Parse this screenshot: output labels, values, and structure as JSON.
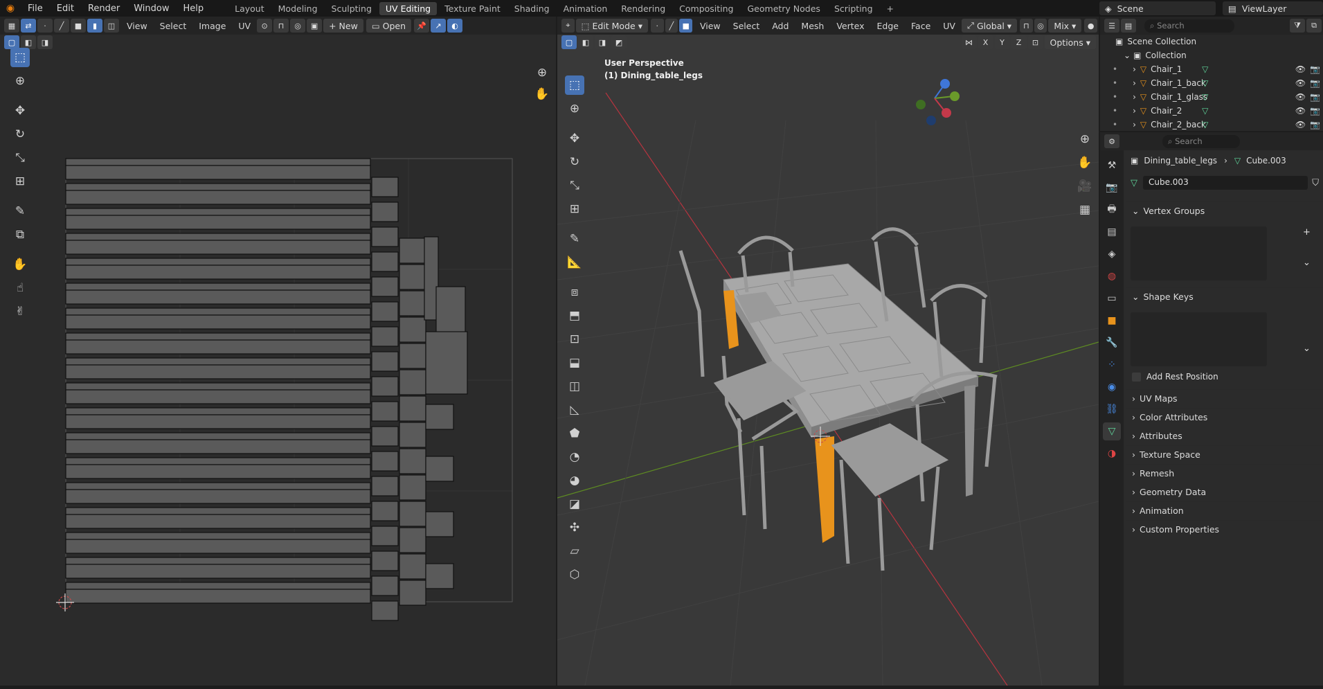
{
  "menu": {
    "items": [
      "File",
      "Edit",
      "Render",
      "Window",
      "Help"
    ]
  },
  "workspaces": {
    "tabs": [
      "Layout",
      "Modeling",
      "Sculpting",
      "UV Editing",
      "Texture Paint",
      "Shading",
      "Animation",
      "Rendering",
      "Compositing",
      "Geometry Nodes",
      "Scripting"
    ],
    "active": "UV Editing",
    "add": "+"
  },
  "scene": {
    "name": "Scene",
    "view_layer": "ViewLayer"
  },
  "uv_editor": {
    "menus": [
      "View",
      "Select",
      "Image",
      "UV"
    ],
    "new_label": "New",
    "open_label": "Open"
  },
  "viewport": {
    "mode": "Edit Mode",
    "menus": [
      "View",
      "Select",
      "Add",
      "Mesh",
      "Vertex",
      "Edge",
      "Face",
      "UV"
    ],
    "orientation": "Global",
    "shading_mix": "Mix",
    "options_label": "Options",
    "axis_x": "X",
    "axis_y": "Y",
    "axis_z": "Z",
    "overlay_line1": "User Perspective",
    "overlay_line2": "(1) Dining_table_legs"
  },
  "outliner": {
    "search_placeholder": "Search",
    "root": "Scene Collection",
    "collection": "Collection",
    "items": [
      "Chair_1",
      "Chair_1_back",
      "Chair_1_glass",
      "Chair_2",
      "Chair_2_back"
    ]
  },
  "properties": {
    "search_placeholder": "Search",
    "breadcrumb_object": "Dining_table_legs",
    "breadcrumb_mesh": "Cube.003",
    "mesh_name": "Cube.003",
    "sections": {
      "vertex_groups": "Vertex Groups",
      "shape_keys": "Shape Keys",
      "add_rest_position": "Add Rest Position",
      "uv_maps": "UV Maps",
      "color_attributes": "Color Attributes",
      "attributes": "Attributes",
      "texture_space": "Texture Space",
      "remesh": "Remesh",
      "geometry_data": "Geometry Data",
      "animation": "Animation",
      "custom_properties": "Custom Properties"
    }
  },
  "colors": {
    "accent": "#4772b3",
    "selection": "#e8931c",
    "active_tab": "#3d3d3d",
    "x_axis": "#c4394a",
    "y_axis": "#6a9a2a",
    "z_axis": "#3f76d9"
  },
  "icons": {
    "blender": "blender-logo-icon",
    "select": "select-box-icon",
    "cursor": "cursor-icon",
    "move": "move-icon",
    "rotate": "rotate-icon",
    "scale": "scale-icon"
  }
}
